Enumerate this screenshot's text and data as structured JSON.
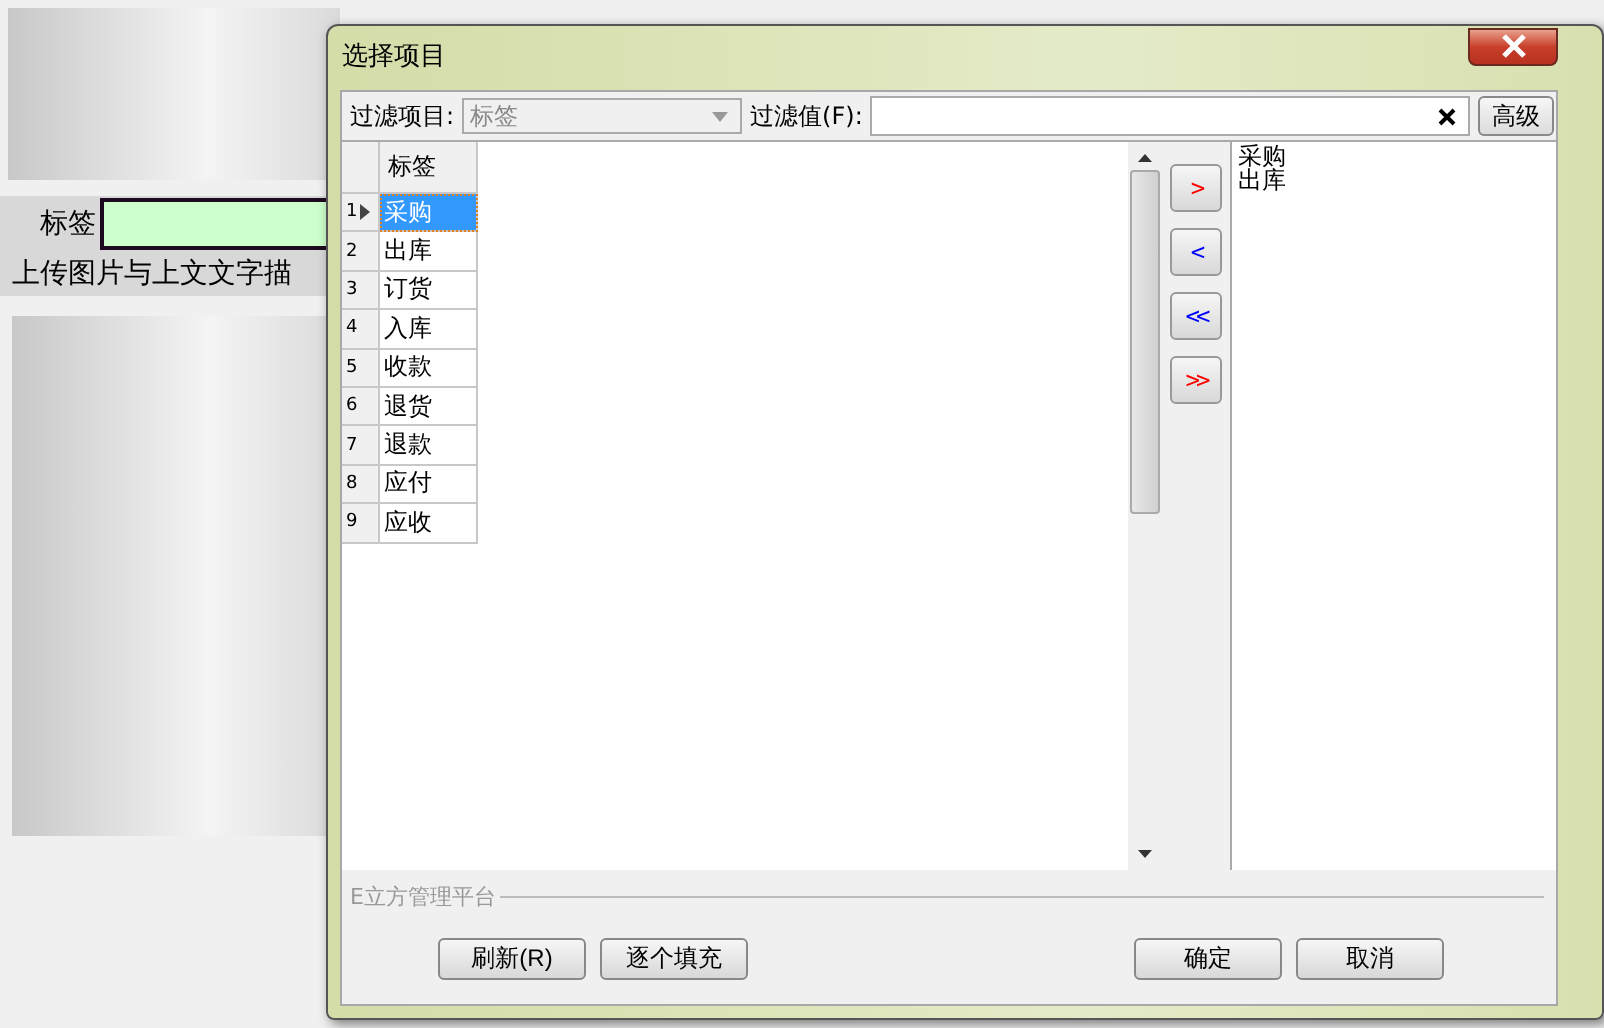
{
  "background_form": {
    "label": "标签",
    "note": "上传图片与上文文字描"
  },
  "dialog": {
    "title": "选择项目",
    "filter": {
      "item_label": "过滤项目:",
      "item_value": "标签",
      "item_disabled": true,
      "value_label": "过滤值(F):",
      "advanced_button": "高级"
    },
    "grid": {
      "column": "标签",
      "rows": [
        {
          "number": "1",
          "label": "采购",
          "selected": true
        },
        {
          "number": "2",
          "label": "出库",
          "selected": false
        },
        {
          "number": "3",
          "label": "订货",
          "selected": false
        },
        {
          "number": "4",
          "label": "入库",
          "selected": false
        },
        {
          "number": "5",
          "label": "收款",
          "selected": false
        },
        {
          "number": "6",
          "label": "退货",
          "selected": false
        },
        {
          "number": "7",
          "label": "退款",
          "selected": false
        },
        {
          "number": "8",
          "label": "应付",
          "selected": false
        },
        {
          "number": "9",
          "label": "应收",
          "selected": false
        }
      ]
    },
    "transfer_buttons": [
      {
        "label": ">",
        "color": "#ff0000"
      },
      {
        "label": "<",
        "color": "#0000ff"
      },
      {
        "label": "<<",
        "color": "#0000ff"
      },
      {
        "label": ">>",
        "color": "#ff0000"
      }
    ],
    "chosen_items": [
      "采购",
      "出库"
    ],
    "group_label": "E立方管理平台",
    "buttons": [
      "刷新(R)",
      "逐个填充",
      "确定",
      "取消"
    ]
  }
}
